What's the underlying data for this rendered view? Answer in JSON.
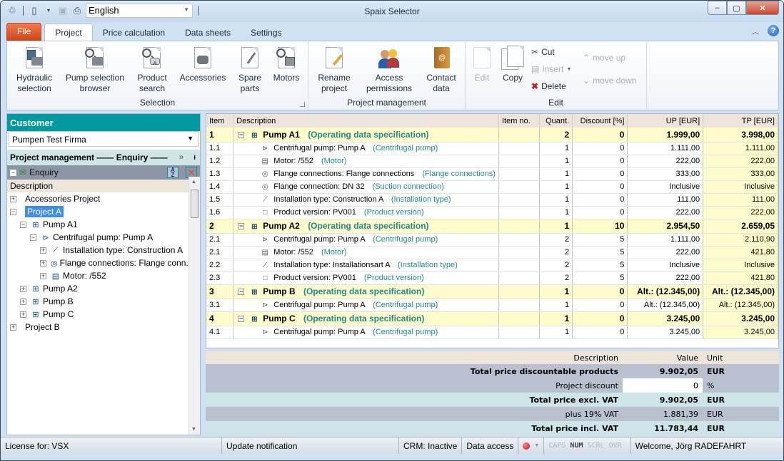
{
  "window": {
    "title": "Spaix Selector",
    "language": "English",
    "controls": {
      "minimize": "–",
      "maximize": "▢",
      "close": "✕"
    }
  },
  "tabs": [
    {
      "label": "File"
    },
    {
      "label": "Project"
    },
    {
      "label": "Price calculation"
    },
    {
      "label": "Data sheets"
    },
    {
      "label": "Settings"
    }
  ],
  "ribbon": {
    "selection": {
      "label": "Selection",
      "buttons": [
        {
          "line1": "Hydraulic",
          "line2": "selection"
        },
        {
          "line1": "Pump selection",
          "line2": "browser"
        },
        {
          "line1": "Product",
          "line2": "search"
        },
        {
          "line1": "Accessories",
          "line2": ""
        },
        {
          "line1": "Spare",
          "line2": "parts"
        },
        {
          "line1": "Motors",
          "line2": ""
        }
      ]
    },
    "project_management": {
      "label": "Project management",
      "buttons": [
        {
          "line1": "Rename",
          "line2": "project"
        },
        {
          "line1": "Access",
          "line2": "permissions"
        },
        {
          "line1": "Contact",
          "line2": "data"
        }
      ]
    },
    "edit": {
      "label": "Edit",
      "edit": "Edit",
      "copy": "Copy",
      "cut": "Cut",
      "insert": "Insert",
      "delete": "Delete",
      "move_up": "move up",
      "move_down": "move down"
    }
  },
  "left_panel": {
    "customer_header": "Customer",
    "customer_value": "Pumpen Test Firma",
    "pm_header": "Project management —— Enquiry ——",
    "enquiry_label": "Enquiry",
    "description_header": "Description",
    "tree": [
      {
        "label": "Accessories Project",
        "level": 0,
        "toggle": "+"
      },
      {
        "label": "Project A",
        "level": 0,
        "toggle": "−",
        "selected": true
      },
      {
        "label": "Pump A1",
        "level": 1,
        "toggle": "−",
        "icon": "pump-group"
      },
      {
        "label": "Centrifugal pump: Pump A",
        "level": 2,
        "toggle": "−",
        "icon": "pump"
      },
      {
        "label": "Installation type: Construction A",
        "level": 3,
        "toggle": "+",
        "icon": "installation"
      },
      {
        "label": "Flange connections: Flange conn...",
        "level": 3,
        "toggle": "+",
        "icon": "flange"
      },
      {
        "label": "Motor: /552",
        "level": 3,
        "toggle": "+",
        "icon": "motor"
      },
      {
        "label": "Pump A2",
        "level": 1,
        "toggle": "+",
        "icon": "pump-group"
      },
      {
        "label": "Pump B",
        "level": 1,
        "toggle": "+",
        "icon": "pump-group"
      },
      {
        "label": "Pump C",
        "level": 1,
        "toggle": "+",
        "icon": "pump-group"
      },
      {
        "label": "Project B",
        "level": 0,
        "toggle": "+"
      }
    ]
  },
  "grid": {
    "columns": [
      "Item",
      "Description",
      "Item no.",
      "Quant.",
      "Discount [%]",
      "UP [EUR]",
      "TP [EUR]"
    ],
    "rows": [
      {
        "item": "1",
        "main": true,
        "icon": "pump-group",
        "desc": "Pump A1",
        "acc": "(Operating data specification)",
        "itemno": "",
        "qty": "2",
        "disc": "0",
        "up": "1.999,00",
        "tp": "3.998,00"
      },
      {
        "item": "1.1",
        "icon": "pump",
        "desc": "Centrifugal pump: Pump A",
        "acc": "(Centrifugal pump)",
        "itemno": "",
        "qty": "1",
        "disc": "0",
        "up": "1.111,00",
        "tp": "1.111,00"
      },
      {
        "item": "1.2",
        "icon": "motor",
        "desc": "Motor: /552",
        "acc": "(Motor)",
        "itemno": "",
        "qty": "1",
        "disc": "0",
        "up": "222,00",
        "tp": "222,00"
      },
      {
        "item": "1.3",
        "icon": "flange",
        "desc": "Flange connections: Flange connections",
        "acc": "(Flange connections)",
        "itemno": "",
        "qty": "1",
        "disc": "0",
        "up": "333,00",
        "tp": "333,00"
      },
      {
        "item": "1.4",
        "icon": "flange",
        "desc": "Flange connection: DN 32",
        "acc": "(Suction connection)",
        "itemno": "",
        "qty": "1",
        "disc": "0",
        "up": "Inclusive",
        "tp": "Inclusive"
      },
      {
        "item": "1.5",
        "icon": "installation",
        "desc": "Installation type: Construction A",
        "acc": "(Installation type)",
        "itemno": "",
        "qty": "1",
        "disc": "0",
        "up": "111,00",
        "tp": "111,00"
      },
      {
        "item": "1.6",
        "icon": "version",
        "desc": "Product version: PV001",
        "acc": "(Product version)",
        "itemno": "",
        "qty": "1",
        "disc": "0",
        "up": "222,00",
        "tp": "222,00"
      },
      {
        "item": "2",
        "main": true,
        "icon": "pump-group",
        "desc": "Pump A2",
        "acc": "(Operating data specification)",
        "itemno": "",
        "qty": "1",
        "disc": "10",
        "up": "2.954,50",
        "tp": "2.659,05"
      },
      {
        "item": "2.1",
        "icon": "pump",
        "desc": "Centrifugal pump: Pump A",
        "acc": "(Centrifugal pump)",
        "itemno": "",
        "qty": "2",
        "disc": "5",
        "up": "1.111,00",
        "tp": "2.110,90"
      },
      {
        "item": "2.1",
        "icon": "motor",
        "desc": "Motor: /552",
        "acc": "(Motor)",
        "itemno": "",
        "qty": "2",
        "disc": "5",
        "up": "222,00",
        "tp": "421,80"
      },
      {
        "item": "2.2",
        "icon": "installation",
        "desc": "Installation type: Installationsart A",
        "acc": "(Installation type)",
        "itemno": "",
        "qty": "2",
        "disc": "5",
        "up": "Inclusive",
        "tp": "Inclusive"
      },
      {
        "item": "2.3",
        "icon": "version",
        "desc": "Product version: PV001",
        "acc": "(Product version)",
        "itemno": "",
        "qty": "2",
        "disc": "5",
        "up": "222,00",
        "tp": "421,80"
      },
      {
        "item": "3",
        "main": true,
        "icon": "pump-group",
        "desc": "Pump B",
        "acc": "(Operating data specification)",
        "itemno": "",
        "qty": "1",
        "disc": "0",
        "up": "Alt.: (12.345,00)",
        "tp": "Alt.: (12.345,00)"
      },
      {
        "item": "3.1",
        "icon": "pump",
        "desc": "Centrifugal pump: Pump A",
        "acc": "(Centrifugal pump)",
        "itemno": "",
        "qty": "1",
        "disc": "0",
        "up": "Alt.: (12.345,00)",
        "tp": "Alt.: (12.345,00)"
      },
      {
        "item": "4",
        "main": true,
        "icon": "pump-group",
        "desc": "Pump C",
        "acc": "(Operating data specification)",
        "itemno": "",
        "qty": "1",
        "disc": "0",
        "up": "3.245,00",
        "tp": "3.245,00"
      },
      {
        "item": "4.1",
        "icon": "pump",
        "desc": "Centrifugal pump: Pump A",
        "acc": "(Centrifugal pump)",
        "itemno": "",
        "qty": "1",
        "disc": "0",
        "up": "3.245,00",
        "tp": "3.245,00"
      }
    ]
  },
  "summary": {
    "headers": {
      "description": "Description",
      "value": "Value",
      "unit": "Unit"
    },
    "rows": [
      {
        "desc": "Total price discountable products",
        "value": "9.902,05",
        "unit": "EUR",
        "bold": true,
        "style": "a"
      },
      {
        "desc": "Project discount",
        "value": "0",
        "unit": "%",
        "bold": false,
        "style": "a",
        "input": true
      },
      {
        "desc": "Total price excl. VAT",
        "value": "9.902,05",
        "unit": "EUR",
        "bold": true,
        "style": "b"
      },
      {
        "desc": "plus 19% VAT",
        "value": "1.881,39",
        "unit": "EUR",
        "bold": false,
        "style": "a"
      },
      {
        "desc": "Total price incl. VAT",
        "value": "11.783,44",
        "unit": "EUR",
        "bold": true,
        "style": "b"
      }
    ]
  },
  "status": {
    "license": "License for: VSX",
    "update": "Update notification",
    "crm": "CRM: Inactive",
    "data_access": "Data access",
    "caps": "CAPS",
    "num": "NUM",
    "scrl": "SCRL",
    "ovr": "OVR",
    "welcome": "Welcome, Jörg RADEFAHRT"
  }
}
